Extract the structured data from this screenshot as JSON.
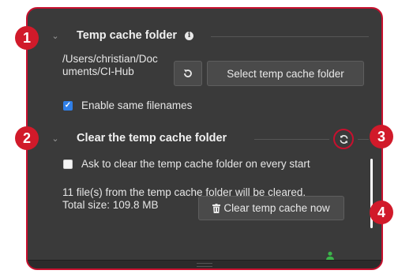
{
  "temp_cache": {
    "title": "Temp cache folder",
    "path": "/Users/christian/Documents/CI-Hub",
    "select_button_label": "Select temp cache folder",
    "enable_same_filenames_label": "Enable same filenames",
    "enable_same_filenames_checked": true
  },
  "clear_cache": {
    "title": "Clear the temp cache folder",
    "ask_on_start_label": "Ask to clear the temp cache folder on every start",
    "ask_on_start_checked": false,
    "files_info": "11 file(s) from the temp cache folder will be cleared.",
    "total_size": "Total size: 109.8 MB",
    "clear_button_label": "Clear temp cache now"
  },
  "markers": [
    "1",
    "2",
    "3",
    "4"
  ],
  "colors": {
    "panel_bg": "#3a3a3a",
    "annotation_red": "#d11a2a",
    "checkbox_blue": "#2f7fe8",
    "user_icon_green": "#3cb44b"
  },
  "icons": [
    "chevron-down-icon",
    "info-icon",
    "reset-icon",
    "refresh-icon",
    "trash-icon",
    "user-icon"
  ]
}
